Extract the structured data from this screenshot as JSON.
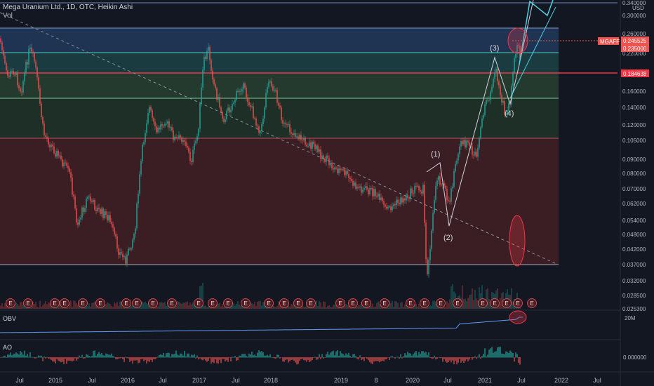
{
  "header": {
    "symbol_line": "Mega Uranium Ltd., 1D, OTC, Heikin Ashi",
    "vol_label": "Vol"
  },
  "currency": "USD",
  "price_axis": {
    "ticks": [
      "0.340000",
      "0.300000",
      "0.260000",
      "0.240000",
      "0.220000",
      "0.190000",
      "0.160000",
      "0.140000",
      "0.120000",
      "0.105000",
      "0.090000",
      "0.080000",
      "0.070000",
      "0.062000",
      "0.054000",
      "0.048000",
      "0.042000",
      "0.037000",
      "0.032000",
      "0.028500",
      "0.025300"
    ],
    "symbol_badge": "MGAFF",
    "last_price": "0.245525",
    "ref_price": "0.235000",
    "red_line_price": "0.184638"
  },
  "time_axis": {
    "labels": [
      "Jul",
      "2015",
      "Jul",
      "2016",
      "Jul",
      "2017",
      "Jul",
      "2018",
      "2019",
      "8",
      "2020",
      "Jul",
      "2021",
      "Jul",
      "2022",
      "Jul"
    ]
  },
  "indicators": {
    "obv": {
      "label": "OBV",
      "axis_value": "20M"
    },
    "ao": {
      "label": "AO",
      "axis_value": "0.000000"
    }
  },
  "annotations": {
    "waves": [
      "(1)",
      "(2)",
      "(3)",
      "(4)"
    ],
    "earnings_marker": "E",
    "earnings_count": 32
  },
  "colors": {
    "background": "#131722",
    "up": "#26a69a",
    "down": "#ef5350",
    "zone_blue": "#2a4a7a",
    "zone_teal": "#1e4b4b",
    "zone_green": "#2d4a34",
    "zone_red": "#4a2226",
    "red_line": "#f23645",
    "cyan_line": "#4dd0e1"
  }
}
